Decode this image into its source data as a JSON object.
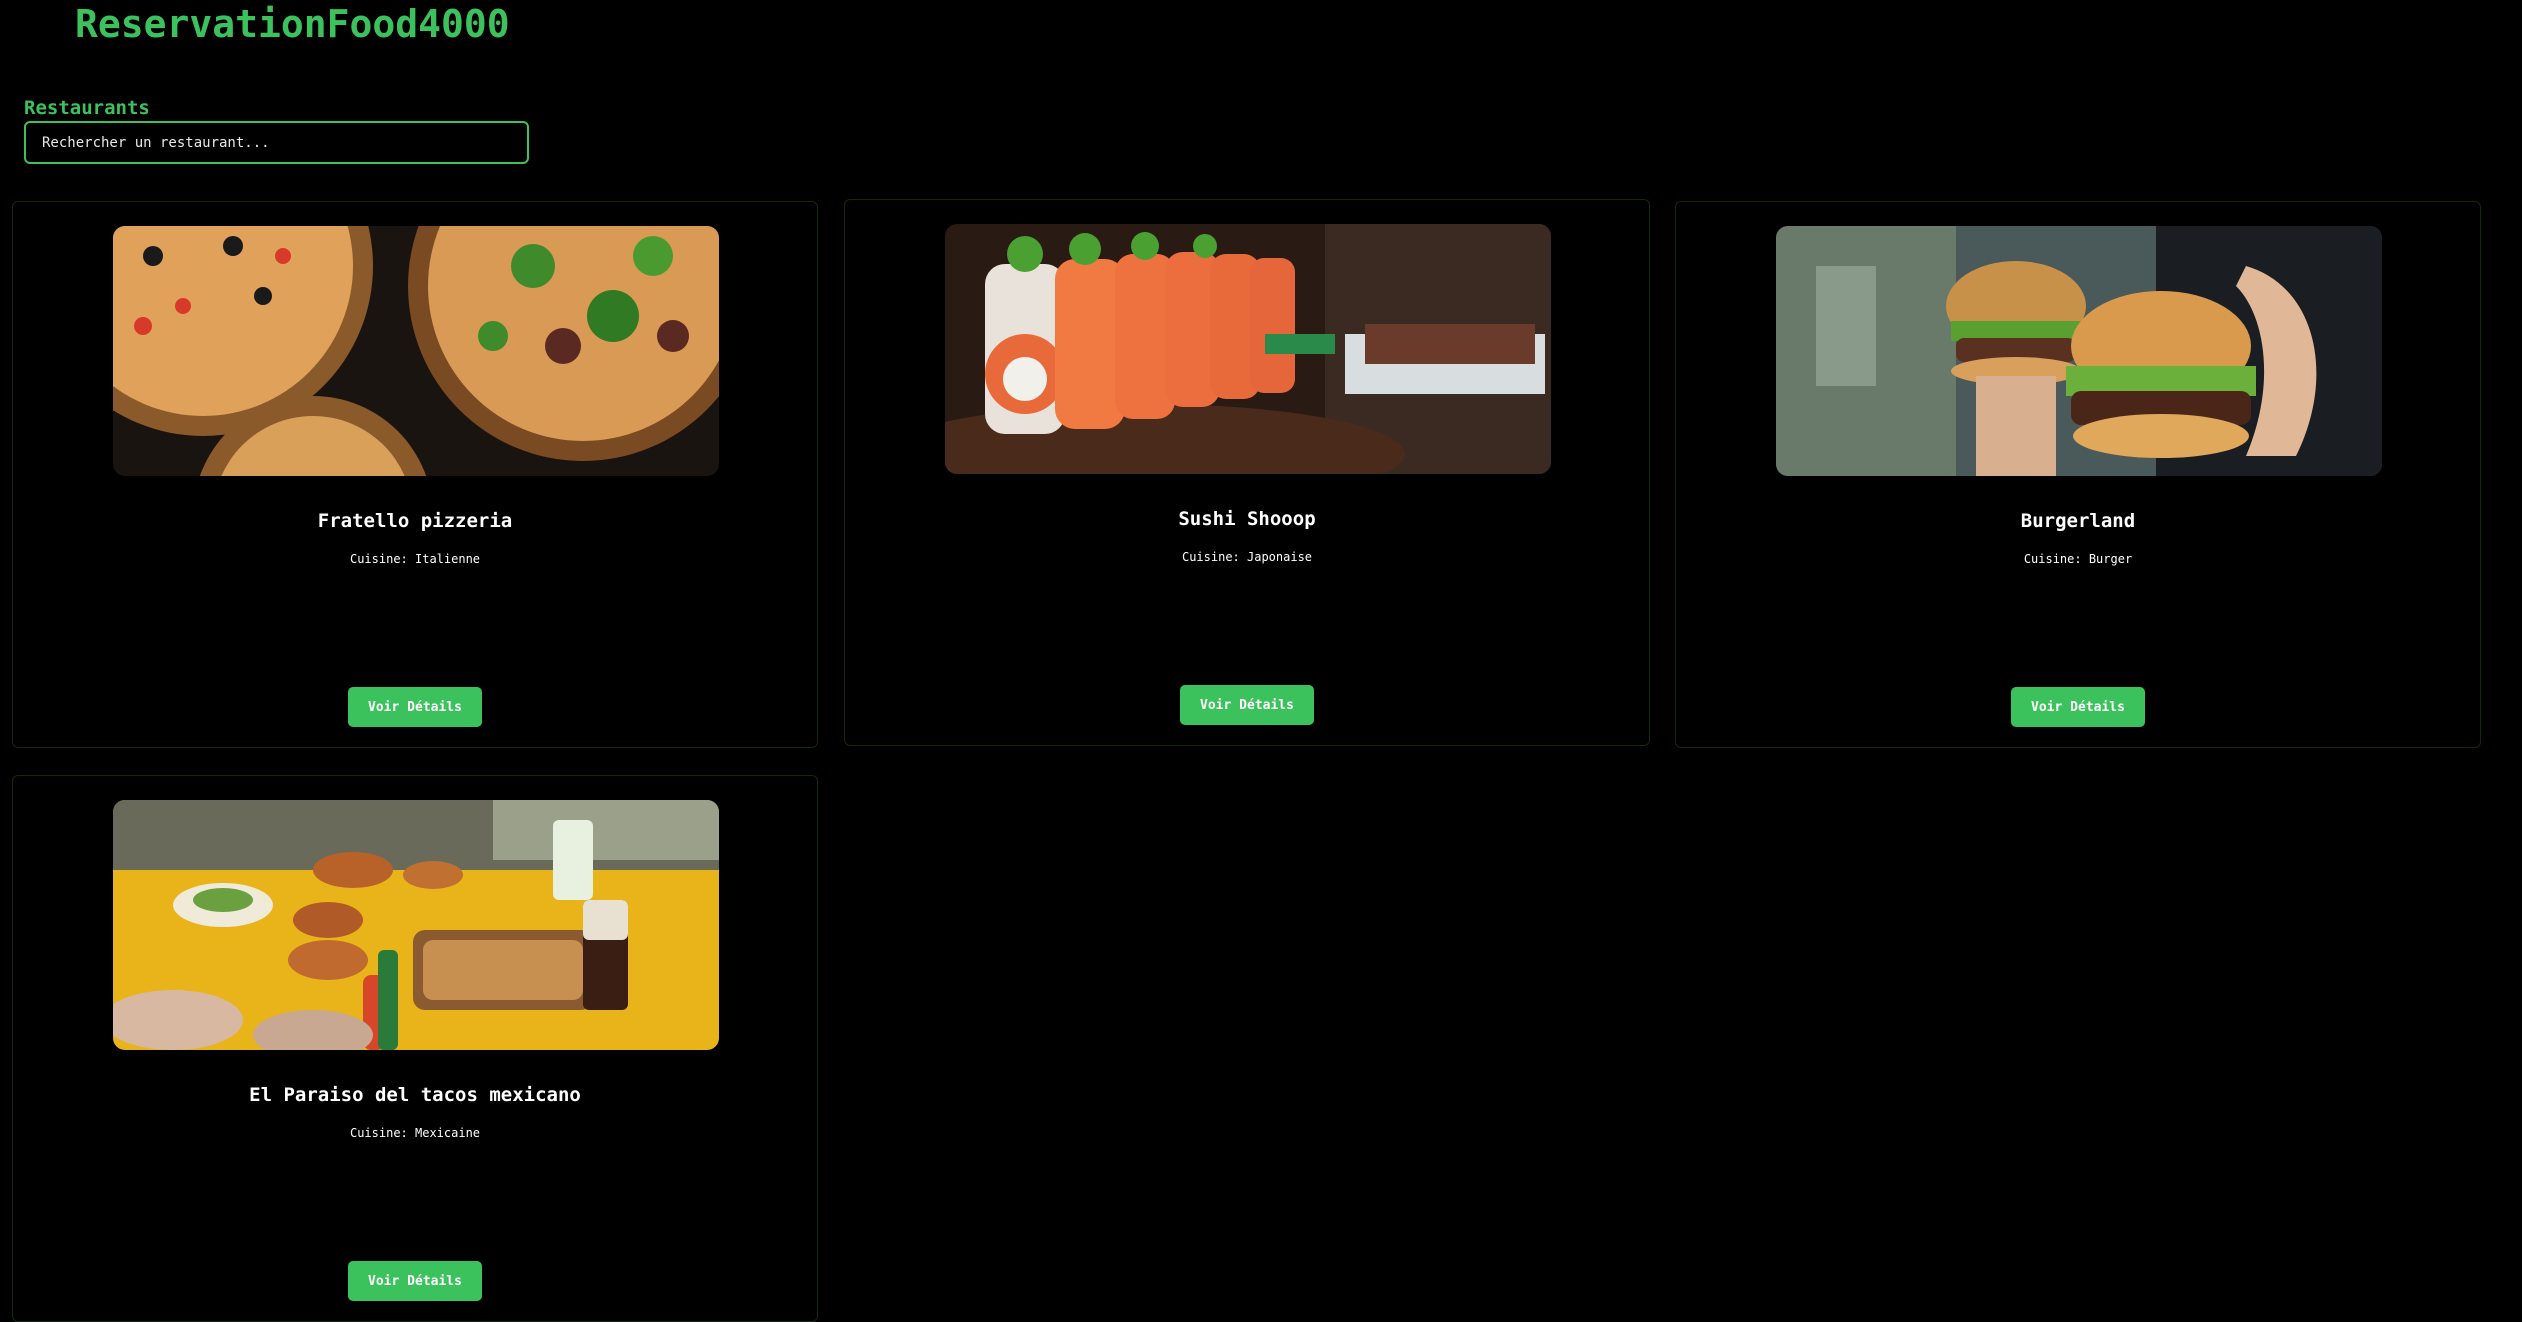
{
  "app": {
    "title": "ReservationFood4000"
  },
  "section": {
    "label": "Restaurants"
  },
  "search": {
    "placeholder": "Rechercher un restaurant..."
  },
  "restaurants": [
    {
      "name": "Fratello pizzeria",
      "cuisine": "Cuisine: Italienne",
      "button_label": "Voir Détails",
      "image": "pizza-photo"
    },
    {
      "name": "Sushi Shooop",
      "cuisine": "Cuisine: Japonaise",
      "button_label": "Voir Détails",
      "image": "sushi-photo"
    },
    {
      "name": "Burgerland",
      "cuisine": "Cuisine: Burger",
      "button_label": "Voir Détails",
      "image": "burger-photo"
    },
    {
      "name": "El Paraiso del tacos mexicano",
      "cuisine": "Cuisine: Mexicaine",
      "button_label": "Voir Détails",
      "image": "tacos-photo"
    }
  ],
  "colors": {
    "accent": "#3cc25c",
    "background": "#000000",
    "card_border": "#0d2a12"
  }
}
